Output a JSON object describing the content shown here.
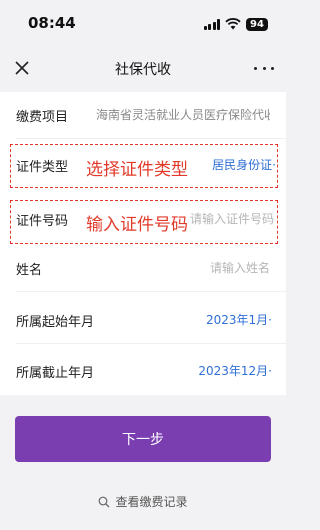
{
  "status_bar": {
    "time": "08:44",
    "battery": "94"
  },
  "nav": {
    "title": "社保代收",
    "close_icon": "close-icon",
    "more_icon": "more-icon"
  },
  "form": {
    "rows": [
      {
        "label": "缴费项目",
        "value": "海南省灵活就业人员医疗保险代收"
      },
      {
        "label": "证件类型",
        "value": "居民身份证"
      },
      {
        "label": "证件号码",
        "placeholder": "请输入证件号码"
      },
      {
        "label": "姓名",
        "placeholder": "请输入姓名"
      },
      {
        "label": "所属起始年月",
        "value": "2023年1月"
      },
      {
        "label": "所属截止年月",
        "value": "2023年12月"
      }
    ],
    "value_suffix": "·"
  },
  "annotations": {
    "select_id_type": "选择证件类型",
    "enter_id_number": "输入证件号码",
    "color": "#e23a2a"
  },
  "actions": {
    "next_label": "下一步",
    "history_label": "查看缴费记录"
  },
  "colors": {
    "accent": "#7a3eb0",
    "link": "#2f6fd6"
  }
}
